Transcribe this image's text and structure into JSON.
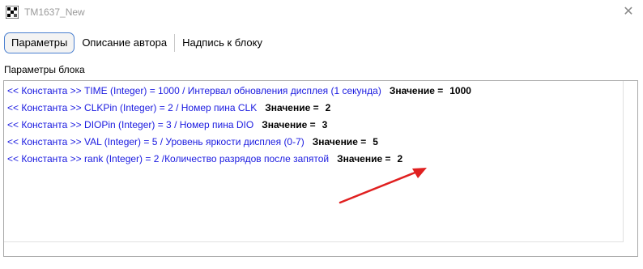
{
  "window": {
    "title": "TM1637_New",
    "close_glyph": "✕"
  },
  "tabs": [
    {
      "label": "Параметры"
    },
    {
      "label": "Описание автора"
    },
    {
      "label": "Надпись к блоку"
    }
  ],
  "section": {
    "label": "Параметры блока"
  },
  "params": [
    {
      "desc": "<< Константа >>  TIME (Integer) = 1000 / Интервал обновления дисплея (1 секунда)",
      "value_label": "Значение =",
      "value": "1000"
    },
    {
      "desc": "<< Константа >>  CLKPin (Integer) = 2 / Номер пина CLK",
      "value_label": "Значение =",
      "value": "2"
    },
    {
      "desc": "<< Константа >>  DIOPin (Integer) = 3 / Номер пина DIO",
      "value_label": "Значение =",
      "value": "3"
    },
    {
      "desc": "<< Константа >>  VAL (Integer) = 5 / Уровень яркости дисплея (0-7)",
      "value_label": "Значение =",
      "value": "5"
    },
    {
      "desc": "<< Константа >>  rank (Integer) = 2 /Количество разрядов после запятой",
      "value_label": "Значение =",
      "value": "2"
    }
  ],
  "colors": {
    "param_text": "#1a1ae0",
    "annotation_arrow": "#e02020",
    "active_tab_border": "#4a7fd0"
  }
}
